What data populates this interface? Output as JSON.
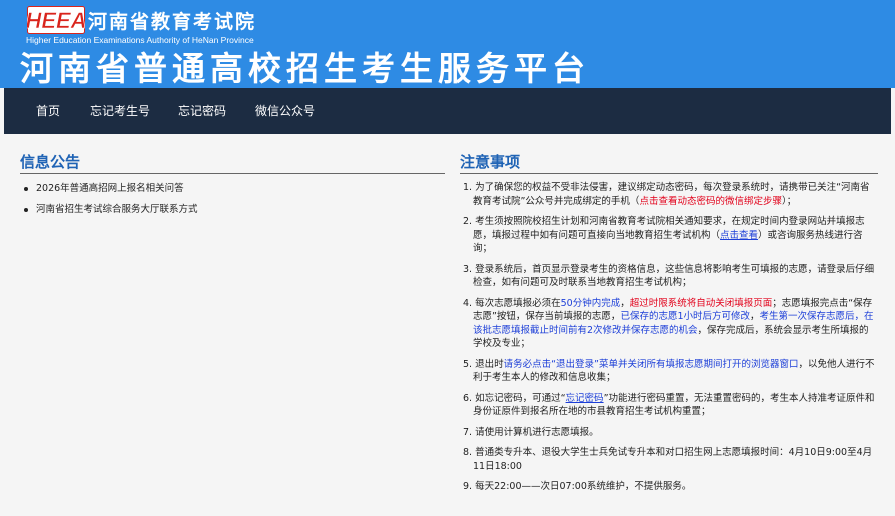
{
  "header": {
    "logo_text": "HEEA",
    "org_cn": "河南省教育考试院",
    "org_en": "Higher Education Examinations Authority of HeNan Province",
    "site_title": "河南省普通高校招生考生服务平台",
    "colors": {
      "banner": "#2e8be4",
      "nav": "#1c2c42",
      "logo_red": "#d9241c"
    }
  },
  "nav": {
    "items": [
      {
        "label": "首页"
      },
      {
        "label": "忘记考生号"
      },
      {
        "label": "忘记密码"
      },
      {
        "label": "微信公众号"
      }
    ]
  },
  "announcements": {
    "title": "信息公告",
    "items": [
      {
        "text": "2026年普通高招网上报名相关问答"
      },
      {
        "text": "河南省招生考试综合服务大厅联系方式"
      }
    ]
  },
  "notices": {
    "title": "注意事项",
    "items": [
      {
        "num": "1.",
        "parts": [
          {
            "text": "为了确保您的权益不受非法侵害，建议绑定动态密码，每次登录系统时，请携带已关注“河南省教育考试院”公众号并完成绑定的手机（"
          },
          {
            "text": "点击查看动态密码的微信绑定步骤",
            "style": "red"
          },
          {
            "text": "）；"
          }
        ]
      },
      {
        "num": "2.",
        "parts": [
          {
            "text": "考生须按照院校招生计划和河南省教育考试院相关通知要求，在规定时间内登录网站并填报志愿，填报过程中如有问题可直接向当地教育招生考试机构（"
          },
          {
            "text": "点击查看",
            "style": "link"
          },
          {
            "text": "）或咨询服务热线进行咨询；"
          }
        ]
      },
      {
        "num": "3.",
        "parts": [
          {
            "text": "登录系统后，首页显示登录考生的资格信息，这些信息将影响考生可填报的志愿，请登录后仔细检查，如有问题可及时联系当地教育招生考试机构；"
          }
        ]
      },
      {
        "num": "4.",
        "parts": [
          {
            "text": "每次志愿填报必须在"
          },
          {
            "text": "50分钟内完成",
            "style": "blue"
          },
          {
            "text": "，"
          },
          {
            "text": "超过时限系统将自动关闭填报页面",
            "style": "red"
          },
          {
            "text": "；志愿填报完点击“保存志愿”按钮，保存当前填报的志愿，"
          },
          {
            "text": "已保存的志愿1小时后方可修改",
            "style": "blue"
          },
          {
            "text": "，"
          },
          {
            "text": "考生第一次保存志愿后，在该批志愿填报截止时间前有2次修改并保存志愿的机会",
            "style": "blue"
          },
          {
            "text": "，保存完成后，系统会显示考生所填报的学校及专业；"
          }
        ]
      },
      {
        "num": "5.",
        "parts": [
          {
            "text": "退出时"
          },
          {
            "text": "请务必点击“退出登录”菜单并关闭所有填报志愿期间打开的浏览器窗口",
            "style": "blue"
          },
          {
            "text": "，以免他人进行不利于考生本人的修改和信息收集；"
          }
        ]
      },
      {
        "num": "6.",
        "parts": [
          {
            "text": "如忘记密码，可通过“"
          },
          {
            "text": "忘记密码",
            "style": "link"
          },
          {
            "text": "”功能进行密码重置，无法重置密码的，考生本人持准考证原件和身份证原件到报名所在地的市县教育招生考试机构重置；"
          }
        ]
      },
      {
        "num": "7.",
        "parts": [
          {
            "text": "请使用计算机进行志愿填报。"
          }
        ]
      },
      {
        "num": "8.",
        "parts": [
          {
            "text": "普通类专升本、退役大学生士兵免试专升本和对口招生网上志愿填报时间：4月10日9:00至4月11日18:00"
          }
        ]
      },
      {
        "num": "9.",
        "parts": [
          {
            "text": "每天22:00——次日07:00系统维护，不提供服务。"
          }
        ]
      }
    ]
  }
}
